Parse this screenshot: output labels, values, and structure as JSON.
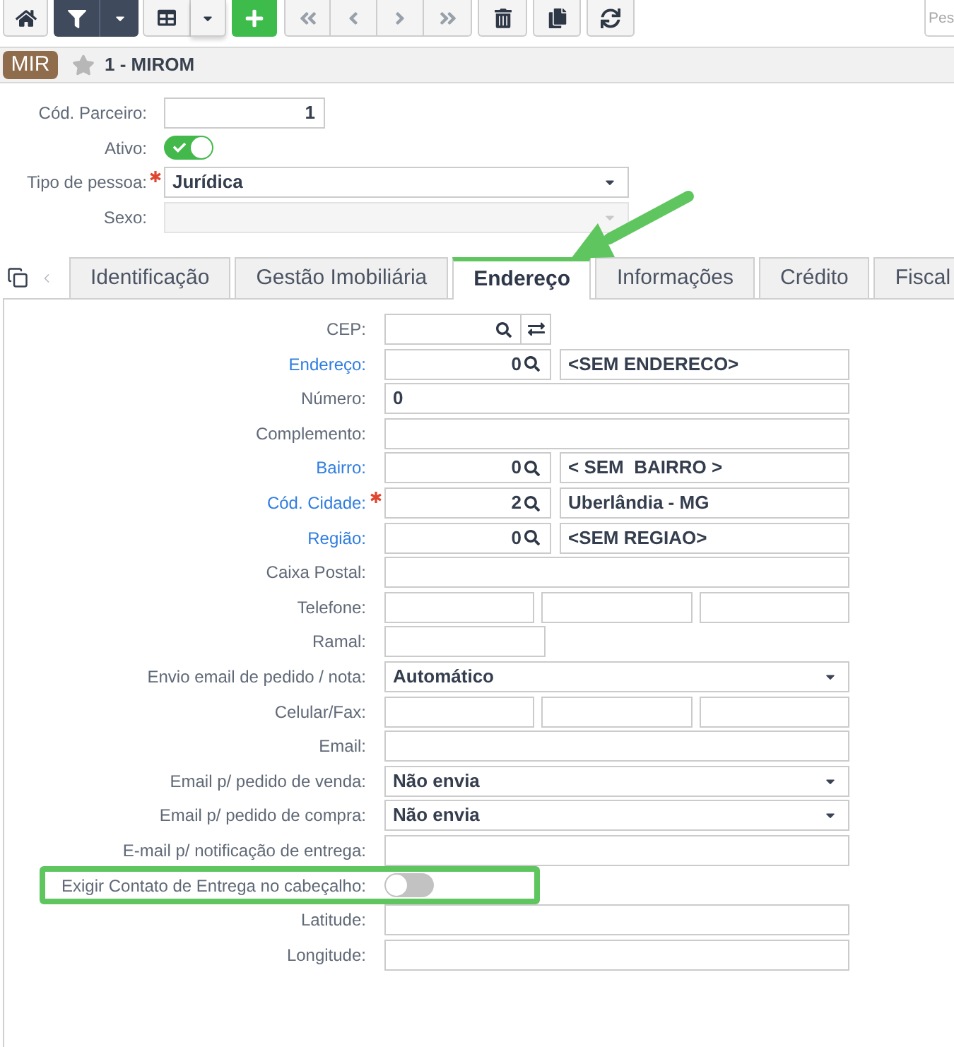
{
  "toolbar": {
    "search": {
      "placeholder": "Pes"
    }
  },
  "record": {
    "badge": "MIR",
    "favorite": false,
    "title": "1 - MIROM"
  },
  "header_fields": [
    {
      "kind": "number",
      "label": "Cód. Parceiro:",
      "required": false,
      "value": "1"
    },
    {
      "kind": "toggle",
      "label": "Ativo:",
      "required": false,
      "on": true
    },
    {
      "kind": "select",
      "label": "Tipo de pessoa:",
      "required": true,
      "disabled": false,
      "value": "Jurídica"
    },
    {
      "kind": "select",
      "label": "Sexo:",
      "required": false,
      "disabled": true
    }
  ],
  "tabs": [
    {
      "label": "Identificação",
      "selected": false
    },
    {
      "label": "Gestão Imobiliária",
      "selected": false
    },
    {
      "label": "Endereço",
      "selected": true
    },
    {
      "label": "Informações",
      "selected": false
    },
    {
      "label": "Crédito",
      "selected": false
    },
    {
      "label": "Fiscal",
      "selected": false
    }
  ],
  "address_fields": [
    {
      "kind": "cep",
      "label": "CEP:",
      "link": false,
      "required": false,
      "highlighted": false
    },
    {
      "kind": "lookup",
      "label": "Endereço:",
      "link": true,
      "required": false,
      "highlighted": false,
      "code": "0",
      "description": "<SEM ENDERECO>"
    },
    {
      "kind": "text",
      "label": "Número:",
      "link": false,
      "required": false,
      "highlighted": false,
      "value": "0"
    },
    {
      "kind": "text",
      "label": "Complemento:",
      "link": false,
      "required": false,
      "highlighted": false
    },
    {
      "kind": "lookup",
      "label": "Bairro:",
      "link": true,
      "required": false,
      "highlighted": false,
      "code": "0",
      "description": "< SEM  BAIRRO >"
    },
    {
      "kind": "lookup",
      "label": "Cód. Cidade:",
      "link": true,
      "required": true,
      "highlighted": false,
      "code": "2",
      "description": "Uberlândia - MG"
    },
    {
      "kind": "lookup",
      "label": "Região:",
      "link": true,
      "required": false,
      "highlighted": false,
      "code": "0",
      "description": "<SEM REGIAO>"
    },
    {
      "kind": "text",
      "label": "Caixa Postal:",
      "link": false,
      "required": false,
      "highlighted": false
    },
    {
      "kind": "triple",
      "label": "Telefone:",
      "link": false,
      "required": false,
      "highlighted": false
    },
    {
      "kind": "short",
      "label": "Ramal:",
      "link": false,
      "required": false,
      "highlighted": false
    },
    {
      "kind": "select",
      "label": "Envio email de pedido / nota:",
      "link": false,
      "required": false,
      "highlighted": false,
      "value": "Automático"
    },
    {
      "kind": "triple",
      "label": "Celular/Fax:",
      "link": false,
      "required": false,
      "highlighted": false
    },
    {
      "kind": "text",
      "label": "Email:",
      "link": false,
      "required": false,
      "highlighted": false
    },
    {
      "kind": "select",
      "label": "Email p/ pedido de venda:",
      "link": false,
      "required": false,
      "highlighted": false,
      "value": "Não envia"
    },
    {
      "kind": "select",
      "label": "Email p/ pedido de compra:",
      "link": false,
      "required": false,
      "highlighted": false,
      "value": "Não envia"
    },
    {
      "kind": "text",
      "label": "E-mail p/ notificação de entrega:",
      "link": false,
      "required": false,
      "highlighted": false
    },
    {
      "kind": "toggle",
      "label": "Exigir Contato de Entrega no cabeçalho:",
      "link": false,
      "required": false,
      "highlighted": true,
      "on": false
    },
    {
      "kind": "text",
      "label": "Latitude:",
      "link": false,
      "required": false,
      "highlighted": false
    },
    {
      "kind": "text",
      "label": "Longitude:",
      "link": false,
      "required": false,
      "highlighted": false
    }
  ]
}
